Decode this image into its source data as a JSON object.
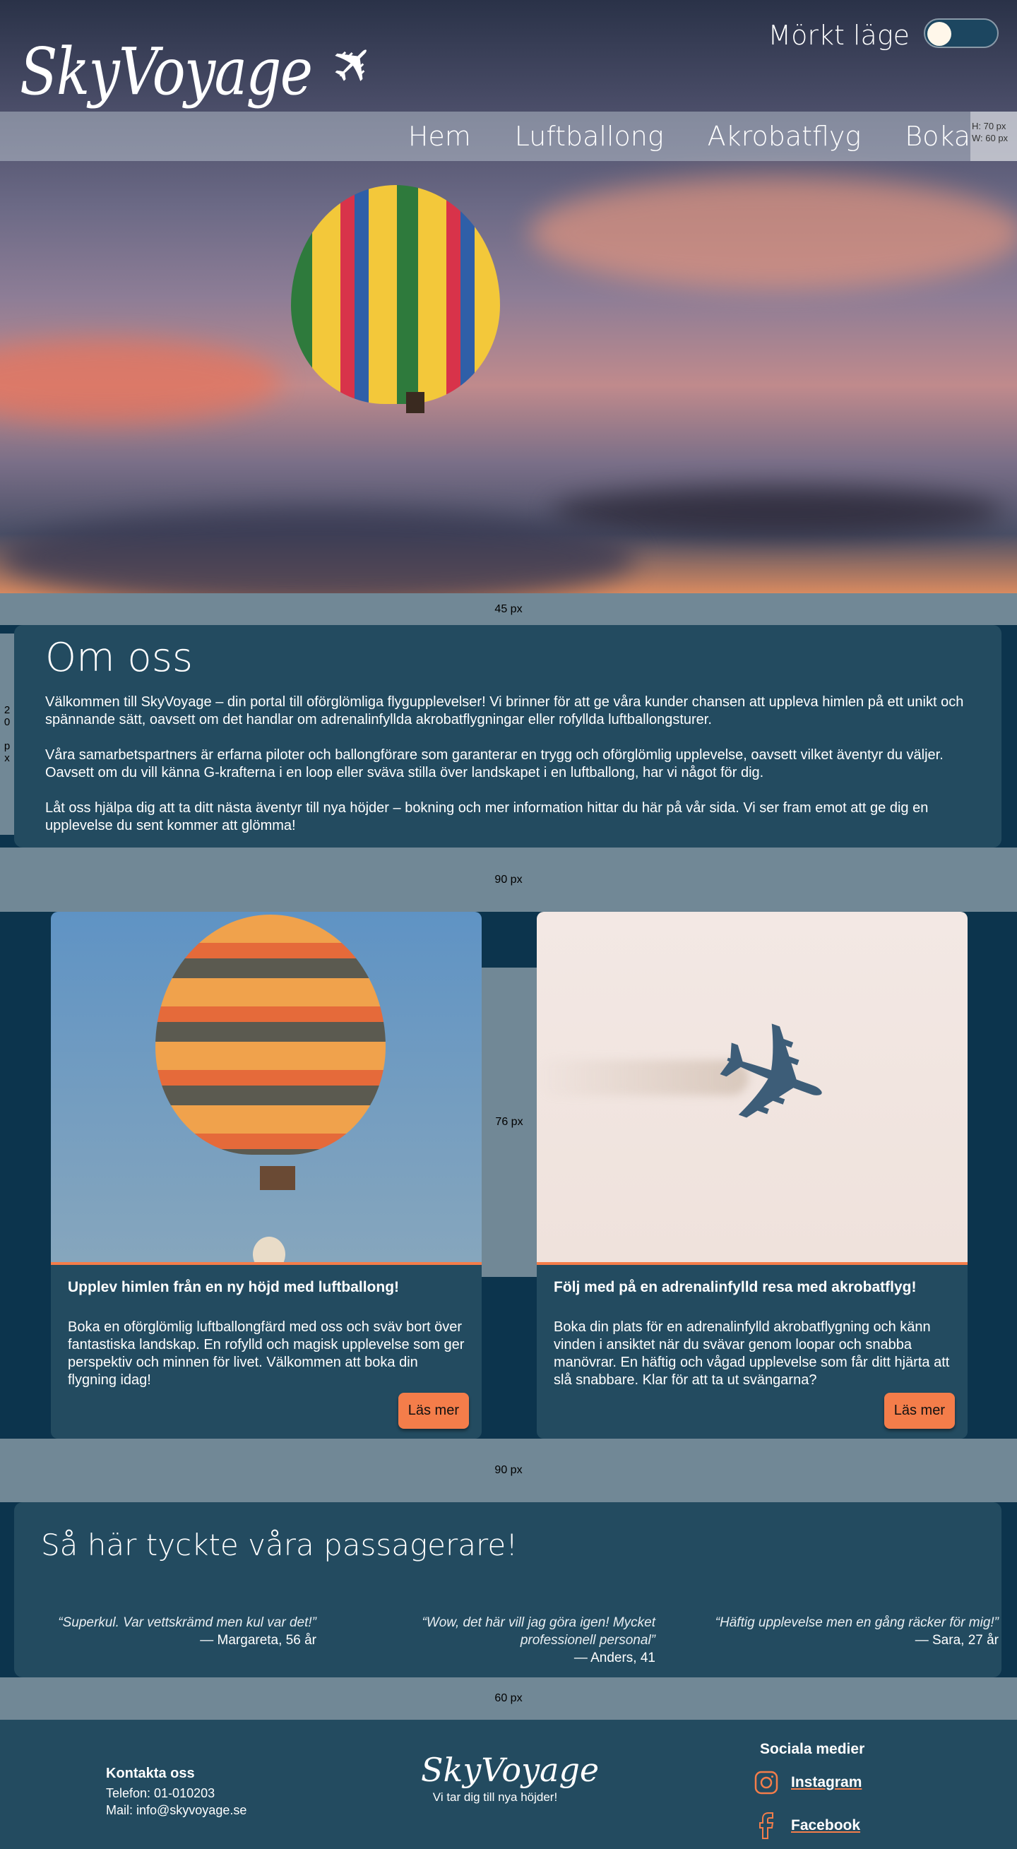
{
  "header": {
    "logo": "SkyVoyage",
    "dark_mode_label": "Mörkt läge",
    "dark_mode_on": false,
    "nav": [
      "Hem",
      "Luftballong",
      "Akrobatflyg",
      "Boka"
    ],
    "dim_note": [
      "H: 70 px",
      "W: 60 px"
    ]
  },
  "spacers": {
    "s1": "45 px",
    "s2": "90 px",
    "s3": "90 px",
    "s4": "60 px",
    "side": "20 px",
    "gap": "76 px"
  },
  "about": {
    "title": "Om oss",
    "paragraphs": [
      "Välkommen till SkyVoyage – din portal till oförglömliga flygupplevelser! Vi brinner för att ge våra kunder chansen att uppleva himlen på ett unikt och spännande sätt, oavsett om det handlar om adrenalinfyllda akrobatflygningar eller rofyllda luftballongsturer.",
      "Våra samarbetspartners är erfarna piloter och ballongförare som garanterar en trygg och oförglömlig upplevelse, oavsett vilket äventyr du väljer. Oavsett om du vill känna G-krafterna i en loop eller sväva stilla över landskapet i en luftballong, har vi något för dig.",
      "Låt oss hjälpa dig att ta ditt nästa äventyr till nya höjder – bokning och mer information hittar du här på vår sida. Vi ser fram emot att ge dig en upplevelse du sent kommer att glömma!"
    ]
  },
  "cards": [
    {
      "title": "Upplev himlen från en ny höjd med luftballong!",
      "text": "Boka en oförglömlig luftballongfärd med oss och sväv bort över fantastiska landskap. En rofylld och magisk upplevelse som ger perspektiv och minnen för livet. Välkommen att boka din flygning idag!",
      "button": "Läs mer"
    },
    {
      "title": "Följ med på en adrenalinfylld resa med akrobatflyg!",
      "text": "Boka din plats för en adrenalinfylld akrobatflygning och känn vinden i ansiktet när du svävar genom loopar och snabba manövrar. En häftig och vågad upplevelse som får ditt hjärta att slå snabbare. Klar för att ta ut svängarna?",
      "button": "Läs mer"
    }
  ],
  "testimonials": {
    "title": "Så här tyckte våra passagerare!",
    "items": [
      {
        "quote": "“Superkul. Var vettskrämd men kul var det!”",
        "author": "— Margareta, 56 år"
      },
      {
        "quote": "“Wow, det här vill jag göra igen! Mycket professionell personal”",
        "author": "— Anders, 41"
      },
      {
        "quote": "“Häftig upplevelse men en gång räcker för mig!”",
        "author": "— Sara, 27 år"
      }
    ]
  },
  "footer": {
    "contact_title": "Kontakta oss",
    "phone": "Telefon: 01-010203",
    "mail": "Mail: info@skyvoyage.se",
    "logo": "SkyVoyage",
    "tagline": "Vi tar dig till nya höjder!",
    "social_title": "Sociala medier",
    "social": [
      "Instagram",
      "Facebook"
    ]
  },
  "colors": {
    "accent": "#f47d4a",
    "card": "#234b60",
    "bg": "#0c344d",
    "spacer": "#718896"
  }
}
